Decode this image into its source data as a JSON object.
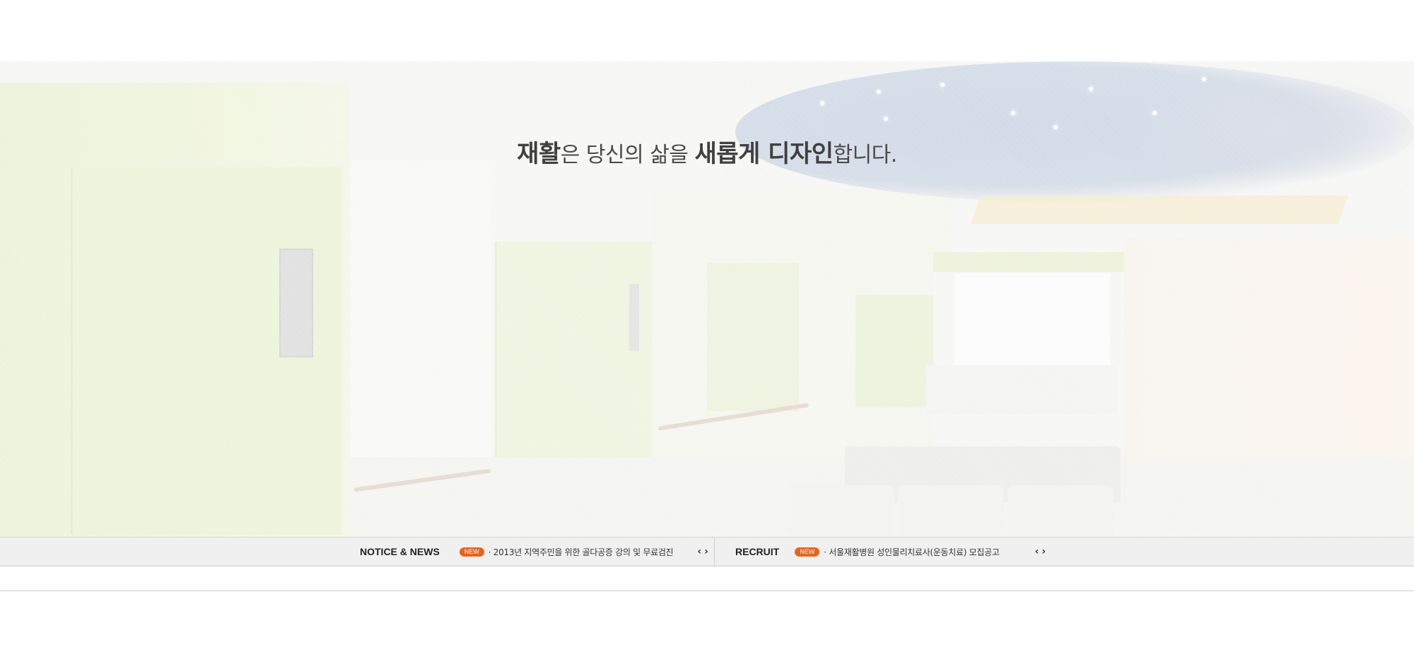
{
  "hero": {
    "headline": {
      "part1": "재활",
      "part2": "은 당신의 삶을 ",
      "part3": "새롭게 디자인",
      "part4": "합니다."
    }
  },
  "notice": {
    "title": "NOTICE & NEWS",
    "badge": "NEW",
    "item": "· 2013년 지역주민을 위한 골다공증 강의 및 무료검진",
    "prev_icon": "chevron-left-icon",
    "next_icon": "chevron-right-icon",
    "prev": "‹",
    "next": "›"
  },
  "recruit": {
    "title": "RECRUIT",
    "badge": "NEW",
    "item": "· 서울재활병원 성인물리치료사(운동치료) 모집공고",
    "prev_icon": "chevron-left-icon",
    "next_icon": "chevron-right-icon",
    "prev": "‹",
    "next": "›"
  },
  "colors": {
    "badge": "#e8641c",
    "bar_bg": "#f0f0f0",
    "text": "#333333"
  }
}
